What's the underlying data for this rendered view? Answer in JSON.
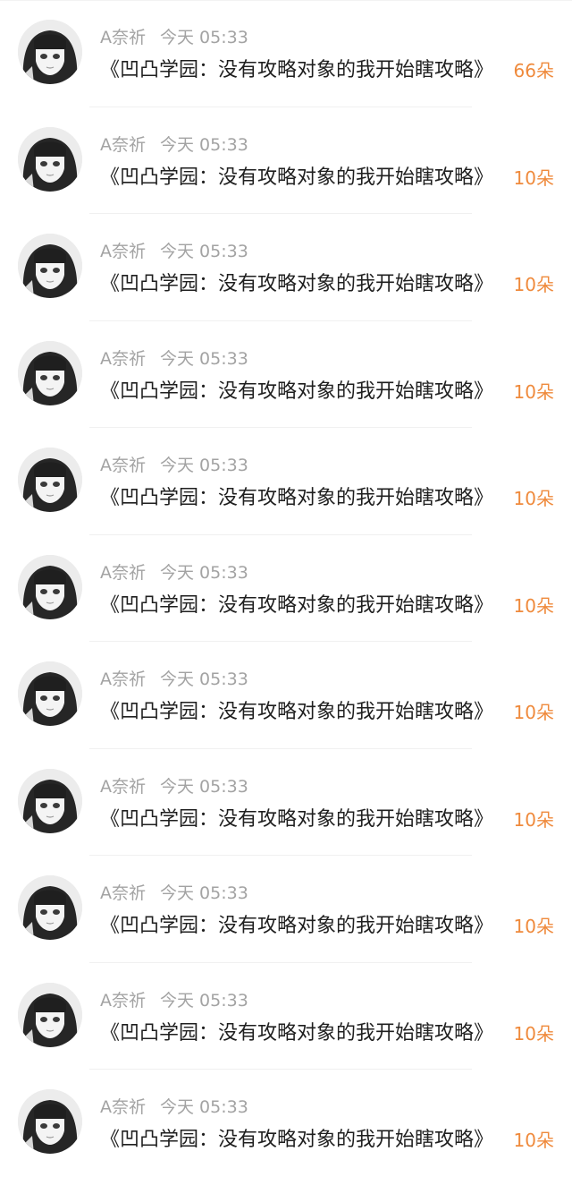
{
  "items": [
    {
      "user": "A奈祈",
      "time": "今天 05:33",
      "text": "《凹凸学园：没有攻略对象的我开始瞎攻略》",
      "count": "66朵"
    },
    {
      "user": "A奈祈",
      "time": "今天 05:33",
      "text": "《凹凸学园：没有攻略对象的我开始瞎攻略》",
      "count": "10朵"
    },
    {
      "user": "A奈祈",
      "time": "今天 05:33",
      "text": "《凹凸学园：没有攻略对象的我开始瞎攻略》",
      "count": "10朵"
    },
    {
      "user": "A奈祈",
      "time": "今天 05:33",
      "text": "《凹凸学园：没有攻略对象的我开始瞎攻略》",
      "count": "10朵"
    },
    {
      "user": "A奈祈",
      "time": "今天 05:33",
      "text": "《凹凸学园：没有攻略对象的我开始瞎攻略》",
      "count": "10朵"
    },
    {
      "user": "A奈祈",
      "time": "今天 05:33",
      "text": "《凹凸学园：没有攻略对象的我开始瞎攻略》",
      "count": "10朵"
    },
    {
      "user": "A奈祈",
      "time": "今天 05:33",
      "text": "《凹凸学园：没有攻略对象的我开始瞎攻略》",
      "count": "10朵"
    },
    {
      "user": "A奈祈",
      "time": "今天 05:33",
      "text": "《凹凸学园：没有攻略对象的我开始瞎攻略》",
      "count": "10朵"
    },
    {
      "user": "A奈祈",
      "time": "今天 05:33",
      "text": "《凹凸学园：没有攻略对象的我开始瞎攻略》",
      "count": "10朵"
    },
    {
      "user": "A奈祈",
      "time": "今天 05:33",
      "text": "《凹凸学园：没有攻略对象的我开始瞎攻略》",
      "count": "10朵"
    },
    {
      "user": "A奈祈",
      "time": "今天 05:33",
      "text": "《凹凸学园：没有攻略对象的我开始瞎攻略》",
      "count": "10朵"
    }
  ],
  "colors": {
    "count": "#ef8a3c",
    "meta": "#a3a3a3",
    "text": "#1f1f1f"
  },
  "icons": {
    "avatar": "anime-girl-avatar"
  }
}
